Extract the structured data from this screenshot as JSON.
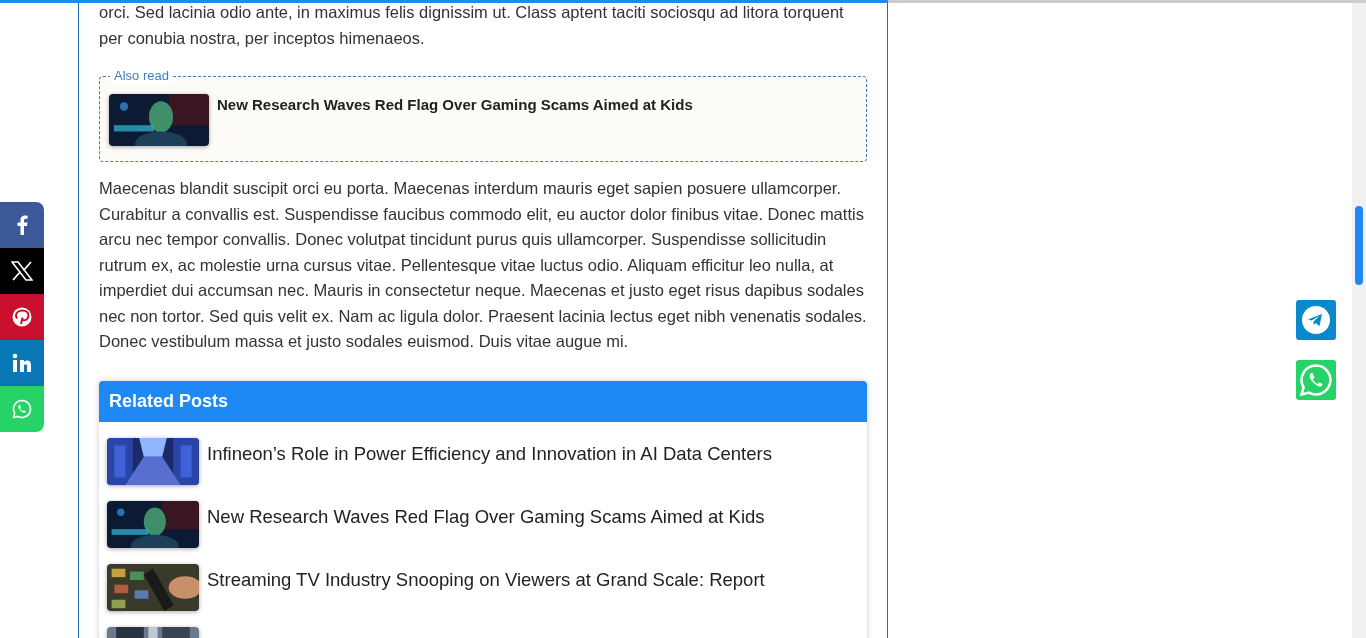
{
  "reading_progress": {
    "level": 0.65
  },
  "intro_paragraph": "orci. Sed lacinia odio ante, in maximus felis dignissim ut. Class aptent taciti sociosqu ad litora torquent per conubia nostra, per inceptos himenaeos.",
  "also_read": {
    "label": "Also read",
    "title": "New Research Waves Red Flag Over Gaming Scams Aimed at Kids"
  },
  "body_paragraph": "Maecenas blandit suscipit orci eu porta. Maecenas interdum mauris eget sapien posuere ullamcorper. Curabitur a convallis est. Suspendisse faucibus commodo elit, eu auctor dolor finibus vitae. Donec mattis arcu nec tempor convallis. Donec volutpat tincidunt purus quis ullamcorper. Suspendisse sollicitudin rutrum ex, ac molestie urna cursus vitae. Pellentesque vitae luctus odio. Aliquam efficitur leo nulla, at imperdiet dui accumsan nec. Mauris in consectetur neque. Maecenas et justo eget risus dapibus sodales nec non tortor. Sed quis velit ex. Nam ac ligula dolor. Praesent lacinia lectus eget nibh venenatis sodales. Donec vestibulum massa et justo sodales euismod. Duis vitae augue mi.",
  "related_posts": {
    "title": "Related Posts",
    "items": [
      {
        "kind": "post",
        "title": "Infineon’s Role in Power Efficiency and Innovation in AI Data Centers"
      },
      {
        "kind": "post",
        "title": "New Research Waves Red Flag Over Gaming Scams Aimed at Kids"
      },
      {
        "kind": "post",
        "title": "Streaming TV Industry Snooping on Viewers at Grand Scale: Report"
      },
      {
        "kind": "picture"
      }
    ]
  },
  "share_bar": [
    {
      "kind": "facebook",
      "color": "#3b5998"
    },
    {
      "kind": "x",
      "color": "#000000"
    },
    {
      "kind": "pinterest",
      "color": "#c8102e"
    },
    {
      "kind": "linkedin",
      "color": "#0a77b5"
    },
    {
      "kind": "whatsapp",
      "color": "#25d366"
    }
  ],
  "floating_buttons": [
    {
      "kind": "telegram",
      "color": "#0a88cc"
    },
    {
      "kind": "whatsapp",
      "color": "#25d366"
    }
  ]
}
